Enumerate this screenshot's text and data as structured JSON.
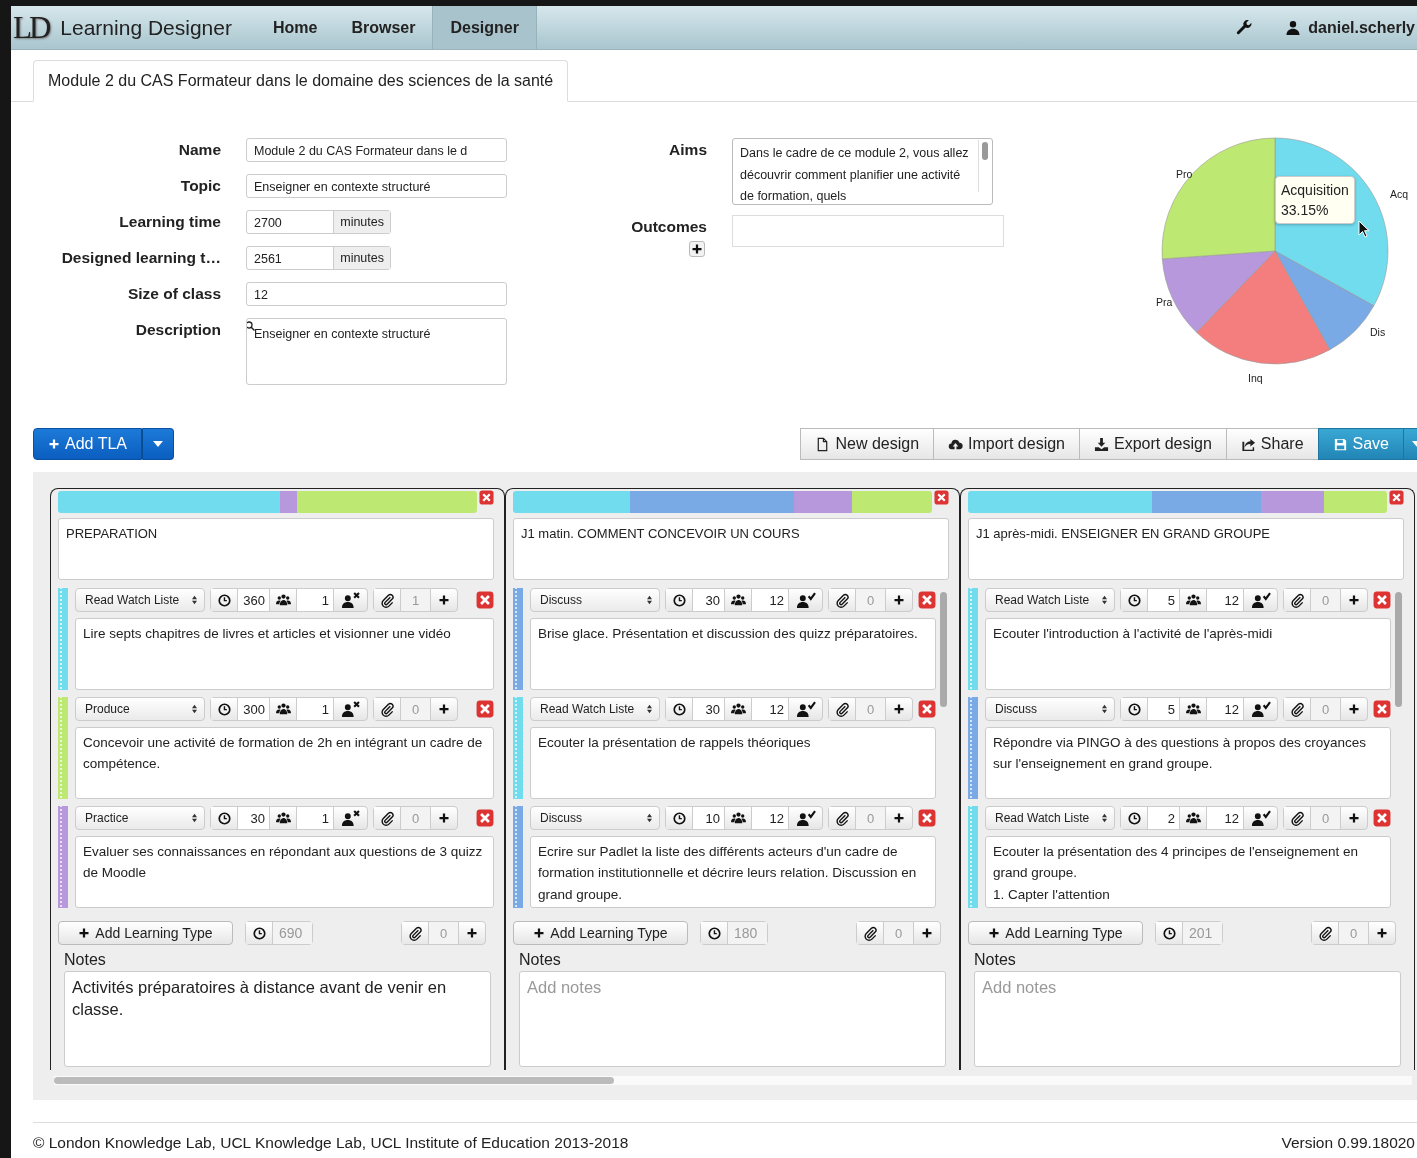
{
  "navbar": {
    "logo": "LD",
    "title": "Learning Designer",
    "tabs": [
      {
        "label": "Home",
        "selected": false
      },
      {
        "label": "Browser",
        "selected": false
      },
      {
        "label": "Designer",
        "selected": true
      }
    ],
    "user": "daniel.scherly"
  },
  "document_tab": "Module 2 du CAS Formateur dans le domaine des sciences de la santé",
  "form": {
    "fields": [
      {
        "label": "Name",
        "value": "Module 2 du CAS Formateur dans le d",
        "kind": "text"
      },
      {
        "label": "Topic",
        "value": "Enseigner en contexte structuré",
        "kind": "text"
      },
      {
        "label": "Learning time",
        "value": "2700",
        "unit": "minutes",
        "kind": "unit"
      },
      {
        "label": "Designed learning t…",
        "value": "2561",
        "unit": "minutes",
        "kind": "unit"
      },
      {
        "label": "Size of class",
        "value": "12",
        "kind": "text"
      },
      {
        "label": "Description",
        "value": "Enseigner en contexte structuré",
        "kind": "textarea"
      }
    ],
    "aims": {
      "label": "Aims",
      "value": "Dans le cadre de ce module 2, vous allez découvrir comment planifier une activité de formation, quels"
    },
    "outcomes": {
      "label": "Outcomes"
    }
  },
  "pie": {
    "slices": [
      {
        "label": "Acq",
        "color": "#72dcef"
      },
      {
        "label": "Dis",
        "color": "#7aaae6"
      },
      {
        "label": "Inq",
        "color": "#f47e7e"
      },
      {
        "label": "Pra",
        "color": "#b898dc"
      },
      {
        "label": "Pro",
        "color": "#bde872"
      }
    ],
    "tooltip": {
      "title": "Acquisition",
      "value": "33.15%"
    }
  },
  "toolbar": {
    "add_button": "Add TLA",
    "buttons": [
      {
        "label": "New design",
        "kind": "new"
      },
      {
        "label": "Import design",
        "kind": "import"
      },
      {
        "label": "Export design",
        "kind": "export"
      },
      {
        "label": "Share",
        "kind": "share"
      },
      {
        "label": "Save",
        "kind": "save"
      }
    ]
  },
  "tlas": [
    {
      "title": "PREPARATION",
      "scrollable": false,
      "bar": [
        {
          "color": "#72dcef"
        },
        {
          "color": "#b898dc"
        },
        {
          "color": "#bde872"
        }
      ],
      "activities": [
        {
          "type": "Read Watch Liste",
          "color": "#72dcef",
          "duration": "360",
          "group_size": "1",
          "individual": true,
          "resources": "1",
          "description": "Lire septs chapitres de livres et articles et visionner une vidéo"
        },
        {
          "type": "Produce",
          "color": "#bde872",
          "duration": "300",
          "group_size": "1",
          "individual": true,
          "resources": "0",
          "description": "Concevoir une activité de formation de 2h en intégrant un cadre de compétence."
        },
        {
          "type": "Practice",
          "color": "#b898dc",
          "duration": "30",
          "group_size": "1",
          "individual": true,
          "resources": "0",
          "description": "Evaluer ses connaissances en répondant aux questions de 3 quizz de Moodle"
        }
      ],
      "add_label": "Add Learning Type",
      "total_time": "690",
      "resources": "0",
      "notes_label": "Notes",
      "notes": {
        "value": "Activités préparatoires à distance avant de venir en classe."
      }
    },
    {
      "title": "J1 matin. COMMENT CONCEVOIR UN COURS",
      "scrollable": true,
      "bar": [
        {
          "color": "#72dcef"
        },
        {
          "color": "#7aaae6"
        },
        {
          "color": "#b898dc"
        },
        {
          "color": "#bde872"
        }
      ],
      "activities": [
        {
          "type": "Discuss",
          "color": "#7aaae6",
          "duration": "30",
          "group_size": "12",
          "individual": false,
          "resources": "0",
          "description": "Brise glace. Présentation et discussion des quizz préparatoires."
        },
        {
          "type": "Read Watch Liste",
          "color": "#72dcef",
          "duration": "30",
          "group_size": "12",
          "individual": false,
          "resources": "0",
          "description": "Ecouter la présentation de rappels théoriques"
        },
        {
          "type": "Discuss",
          "color": "#7aaae6",
          "duration": "10",
          "group_size": "12",
          "individual": false,
          "resources": "0",
          "description": "Ecrire sur Padlet la liste des différents acteurs d'un cadre de formation institutionnelle et décrire leurs relation. Discussion en grand groupe."
        }
      ],
      "add_label": "Add Learning Type",
      "total_time": "180",
      "resources": "0",
      "notes_label": "Notes",
      "notes": {
        "placeholder": "Add notes"
      }
    },
    {
      "title": "J1 après-midi. ENSEIGNER EN GRAND GROUPE",
      "scrollable": true,
      "bar": [
        {
          "color": "#72dcef"
        },
        {
          "color": "#7aaae6"
        },
        {
          "color": "#b898dc"
        },
        {
          "color": "#bde872"
        }
      ],
      "activities": [
        {
          "type": "Read Watch Liste",
          "color": "#72dcef",
          "duration": "5",
          "group_size": "12",
          "individual": false,
          "resources": "0",
          "description": "Ecouter l'introduction à l'activité de l'après-midi"
        },
        {
          "type": "Discuss",
          "color": "#7aaae6",
          "duration": "5",
          "group_size": "12",
          "individual": false,
          "resources": "0",
          "description": "Répondre via PINGO à des questions à propos des croyances sur l'enseignement en grand groupe."
        },
        {
          "type": "Read Watch Liste",
          "color": "#72dcef",
          "duration": "2",
          "group_size": "12",
          "individual": false,
          "resources": "0",
          "description": "Ecouter la présentation des 4 principes de l'enseignement en grand groupe.\n1. Capter l'attention"
        }
      ],
      "add_label": "Add Learning Type",
      "total_time": "201",
      "resources": "0",
      "notes_label": "Notes",
      "notes": {
        "placeholder": "Add notes"
      }
    }
  ],
  "footer": {
    "copyright": "© London Knowledge Lab, UCL Knowledge Lab, UCL Institute of Education 2013-2018",
    "version": "Version 0.99.18020"
  }
}
